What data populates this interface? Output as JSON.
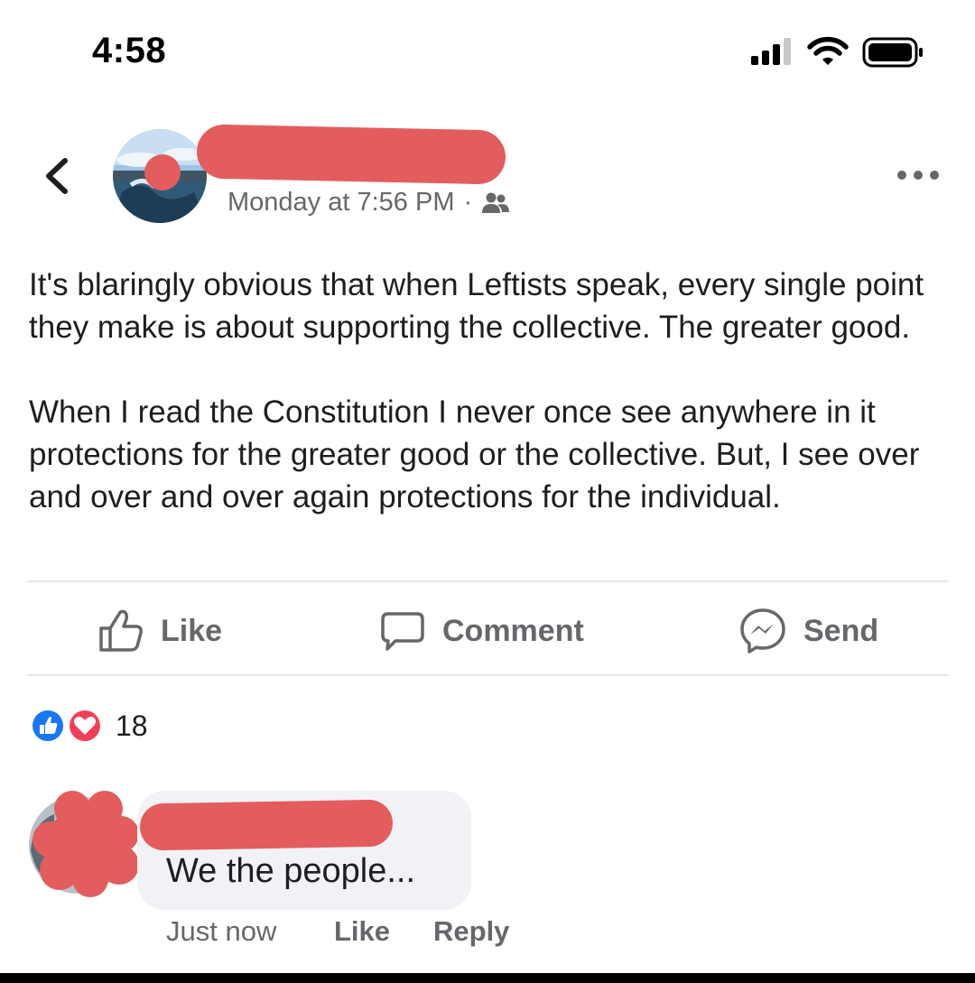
{
  "status_bar": {
    "time": "4:58"
  },
  "post": {
    "timestamp": "Monday at 7:56 PM",
    "separator": "·",
    "paragraphs": [
      "It's blaringly obvious that when Leftists speak, every single point they make is about supporting the collective. The greater good.",
      "When I read the Constitution I never once see anywhere in it protections for the greater good or the collective. But, I see over and over and over again protections for the individual."
    ]
  },
  "actions": {
    "like": "Like",
    "comment": "Comment",
    "send": "Send"
  },
  "reactions": {
    "count": "18"
  },
  "comment": {
    "text": "We the people...",
    "time": "Just now",
    "like": "Like",
    "reply": "Reply"
  },
  "colors": {
    "redaction": "#e35d5e",
    "secondary_text": "#65676b",
    "like_blue": "#1877f2",
    "love_red": "#f33e58"
  }
}
